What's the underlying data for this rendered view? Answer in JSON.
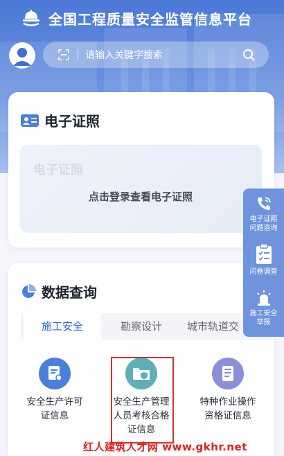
{
  "header": {
    "app_title": "全国工程质量安全监管信息平台",
    "logo_icon": "construction-helmet-logo",
    "avatar_icon": "user-avatar-icon"
  },
  "search": {
    "placeholder": "请输入关键字搜索",
    "scan_icon": "scan-icon",
    "search_icon": "search-icon"
  },
  "certificate": {
    "title": "电子证照",
    "watermark": "电子证照",
    "login_prompt": "点击登录查看电子证照"
  },
  "data_query": {
    "title": "数据查询",
    "tabs": [
      {
        "label": "施工安全",
        "active": true
      },
      {
        "label": "勘察设计",
        "active": false
      },
      {
        "label": "城市轨道交",
        "active": false
      }
    ],
    "services": [
      {
        "lines": [
          "安全生产许可",
          "证信息"
        ],
        "icon": "license-icon",
        "color": "#4a7fdc"
      },
      {
        "lines": [
          "安全生产管理",
          "人员考核合格",
          "证信息"
        ],
        "icon": "folder-shield-icon",
        "color": "#5fb0b6"
      },
      {
        "lines": [
          "特种作业操作",
          "资格证信息"
        ],
        "icon": "document-icon",
        "color": "#8b8fd8"
      }
    ]
  },
  "float_bar": {
    "items": [
      {
        "lines": [
          "电子证照",
          "问题咨询"
        ],
        "icon": "phone-support-icon"
      },
      {
        "lines": [
          "问卷调查"
        ],
        "icon": "survey-clipboard-icon"
      },
      {
        "lines": [
          "施工安全",
          "举报"
        ],
        "icon": "alarm-light-icon"
      }
    ]
  },
  "watermark_text": "红人建筑人才网 www.gkhr.net",
  "colors": {
    "brand_blue": "#4b78d6",
    "active_tab": "#2a66d8",
    "highlight_border": "#d82f2f",
    "watermark": "#e02020"
  }
}
